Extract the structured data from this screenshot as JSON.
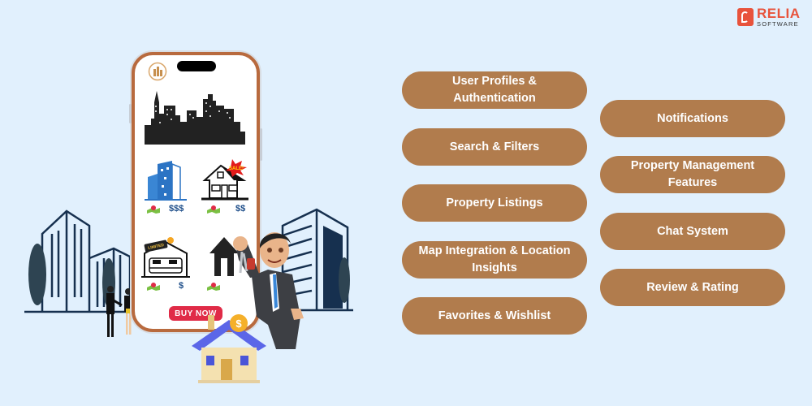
{
  "brand": {
    "name": "RELIA",
    "sub": "SOFTWARE",
    "accent": "#e8533c"
  },
  "colors": {
    "background": "#e1f0fd",
    "pill": "#b17c4d",
    "pill_text": "#ffffff",
    "phone_frame": "#b86a3e"
  },
  "phone": {
    "listings": [
      {
        "icon": "office-building-icon",
        "price": "$$$"
      },
      {
        "icon": "house-sale-icon",
        "badge": "SALE!",
        "price": "$$"
      },
      {
        "icon": "garage-limited-offer-icon",
        "badge": "LIMITED OFFER",
        "price": "$"
      },
      {
        "icon": "house-silhouette-icon",
        "price": "$"
      }
    ],
    "cta": "BUY NOW"
  },
  "features": {
    "left": [
      {
        "label": "User Profiles & Authentication"
      },
      {
        "label": "Search & Filters"
      },
      {
        "label": "Property Listings"
      },
      {
        "label": "Map Integration & Location Insights"
      },
      {
        "label": "Favorites & Wishlist"
      }
    ],
    "right": [
      {
        "label": "Notifications"
      },
      {
        "label": "Property Management Features"
      },
      {
        "label": "Chat System"
      },
      {
        "label": "Review & Rating"
      }
    ]
  }
}
